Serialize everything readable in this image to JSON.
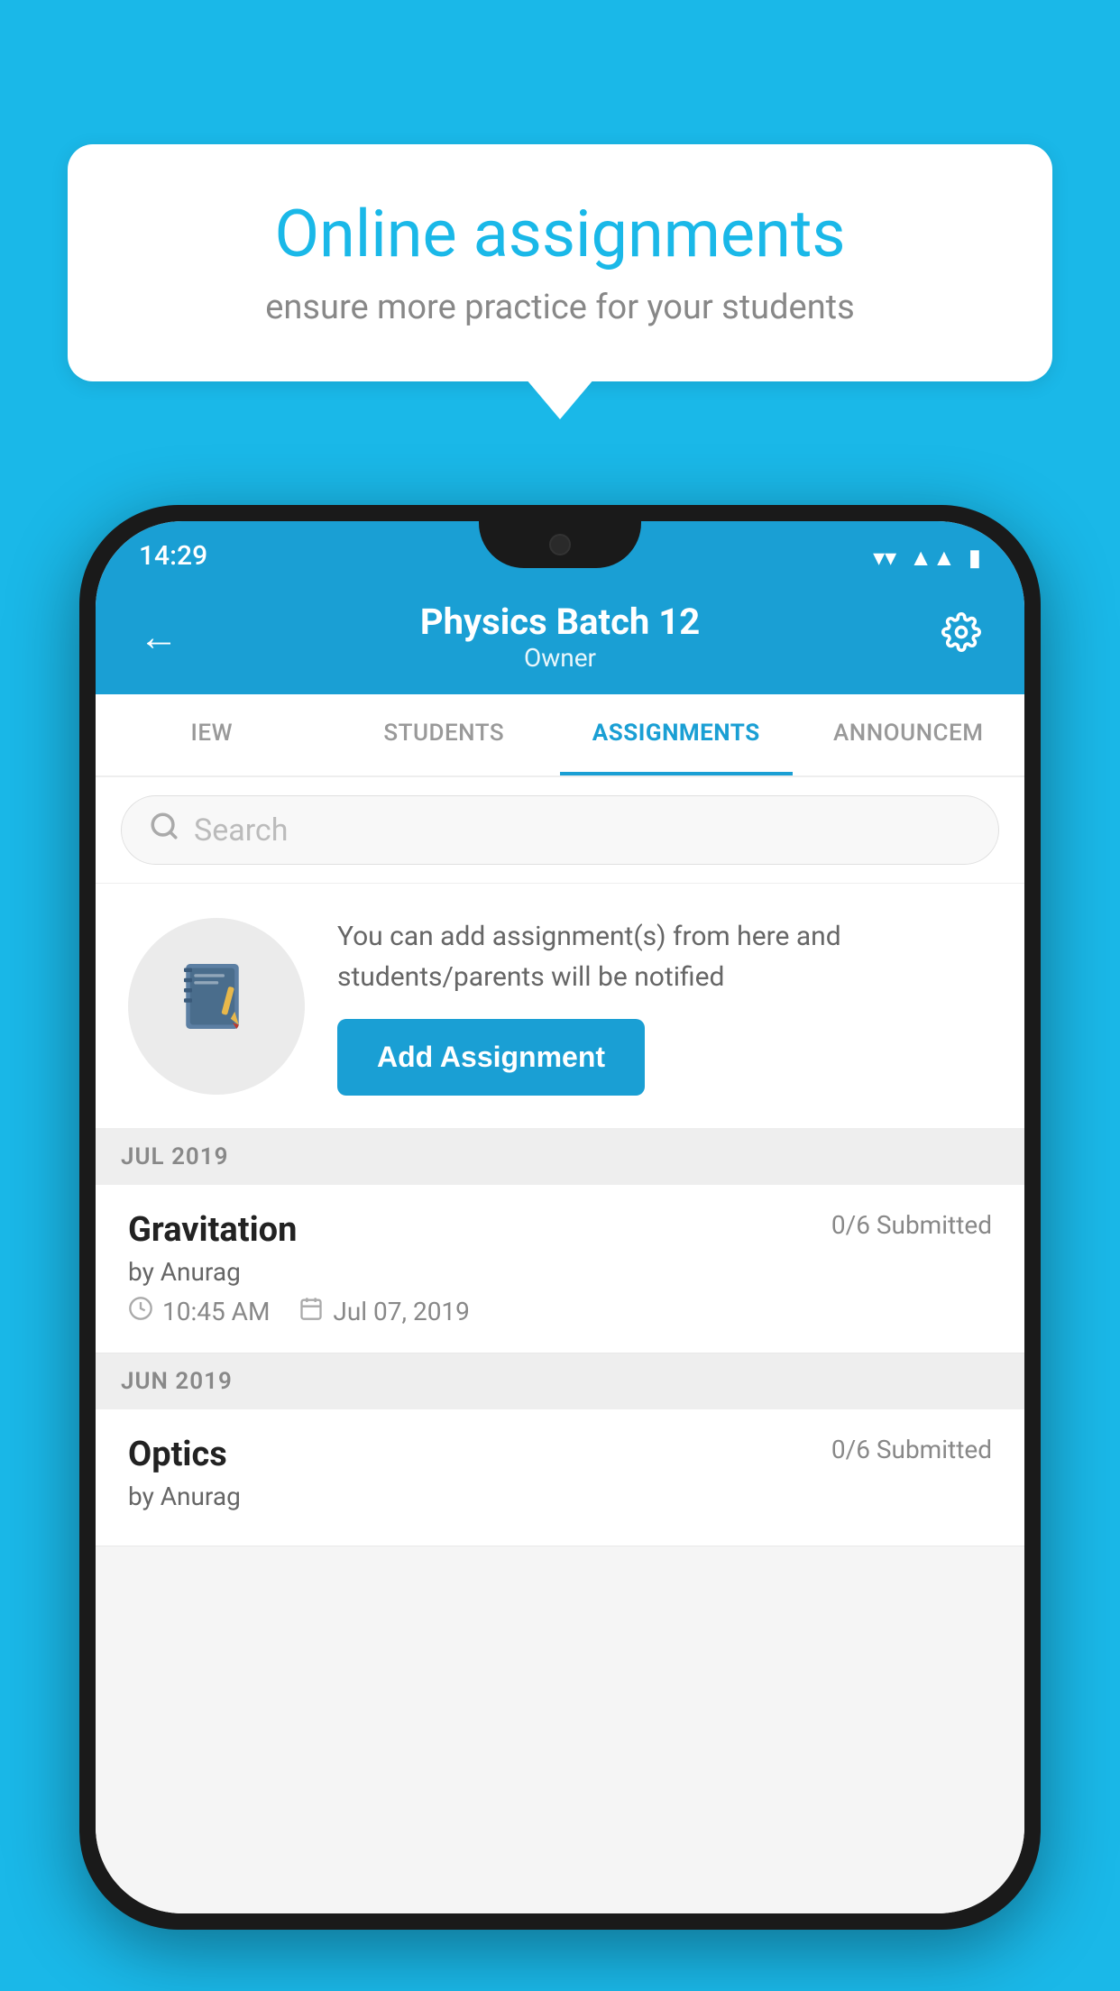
{
  "background_color": "#1ab8e8",
  "speech_bubble": {
    "title": "Online assignments",
    "subtitle": "ensure more practice for your students"
  },
  "phone": {
    "status_bar": {
      "time": "14:29",
      "wifi_icon": "wifi",
      "signal_icon": "signal",
      "battery_icon": "battery"
    },
    "header": {
      "title": "Physics Batch 12",
      "subtitle": "Owner",
      "back_label": "←",
      "settings_label": "⚙"
    },
    "tabs": [
      {
        "label": "IEW",
        "active": false
      },
      {
        "label": "STUDENTS",
        "active": false
      },
      {
        "label": "ASSIGNMENTS",
        "active": true
      },
      {
        "label": "ANNOUNCEM",
        "active": false
      }
    ],
    "search": {
      "placeholder": "Search"
    },
    "promo": {
      "text": "You can add assignment(s) from here and students/parents will be notified",
      "button_label": "Add Assignment"
    },
    "sections": [
      {
        "header": "JUL 2019",
        "assignments": [
          {
            "name": "Gravitation",
            "submitted": "0/6 Submitted",
            "by": "by Anurag",
            "time": "10:45 AM",
            "date": "Jul 07, 2019"
          }
        ]
      },
      {
        "header": "JUN 2019",
        "assignments": [
          {
            "name": "Optics",
            "submitted": "0/6 Submitted",
            "by": "by Anurag",
            "time": "",
            "date": ""
          }
        ]
      }
    ]
  }
}
